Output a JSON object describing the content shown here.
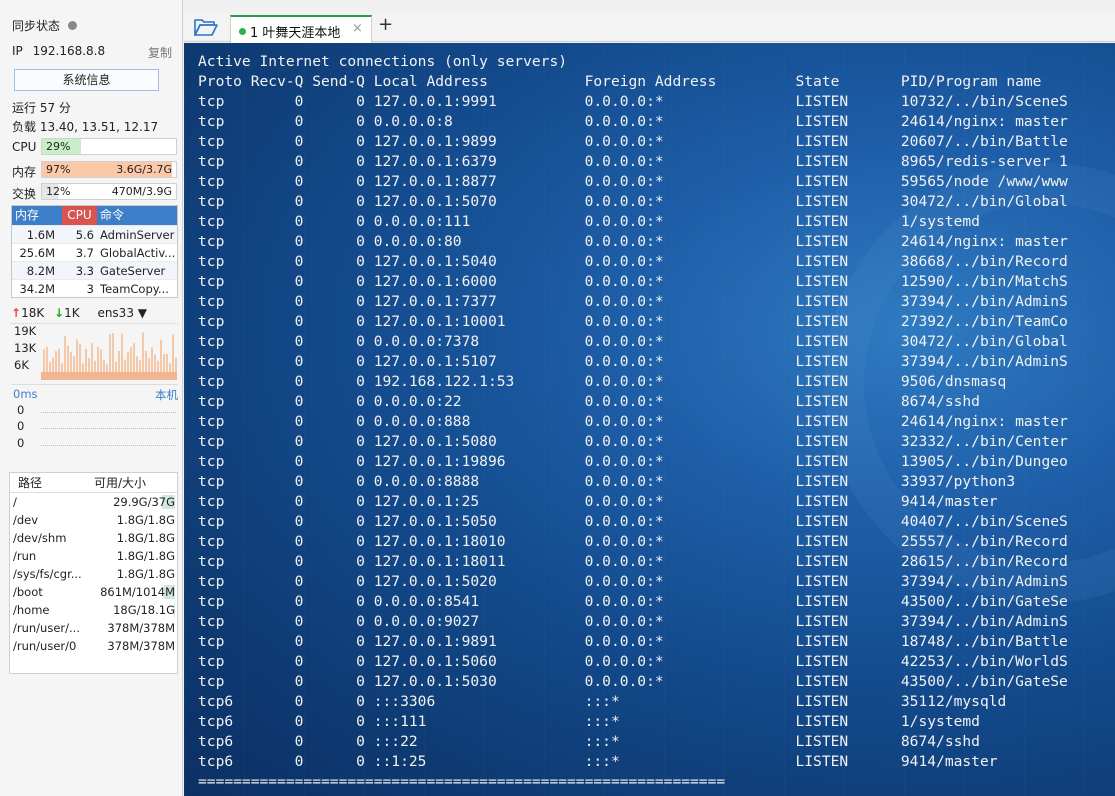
{
  "sidebar": {
    "sync_label": "同步状态",
    "ip_label": "IP",
    "ip_value": "192.168.8.8",
    "copy_label": "复制",
    "sysinfo_button": "系统信息",
    "uptime": "运行 57 分",
    "load": "负载 13.40, 13.51, 12.17",
    "cpu": {
      "label": "CPU",
      "percent_text": "29%",
      "fraction": 0.29,
      "color": "#c8f0c8"
    },
    "mem": {
      "label": "内存",
      "percent_text": "97%",
      "value": "3.6G/3.7G",
      "fraction": 0.97,
      "color": "#fcc9a8"
    },
    "swap": {
      "label": "交换",
      "percent_text": "12%",
      "value": "470M/3.9G",
      "fraction": 0.12,
      "color": "#e6e6e6"
    },
    "proc_headers": {
      "mem": "内存",
      "cpu": "CPU",
      "cmd": "命令"
    },
    "processes": [
      {
        "mem": "1.6M",
        "cpu": "5.6",
        "cmd": "AdminServer"
      },
      {
        "mem": "25.6M",
        "cpu": "3.7",
        "cmd": "GlobalActiv..."
      },
      {
        "mem": "8.2M",
        "cpu": "3.3",
        "cmd": "GateServer"
      },
      {
        "mem": "34.2M",
        "cpu": "3",
        "cmd": "TeamCopy..."
      }
    ],
    "net": {
      "up": "18K",
      "down": "1K",
      "iface": "ens33",
      "ticks": [
        "19K",
        "13K",
        "6K"
      ]
    },
    "ping": {
      "ms": "0ms",
      "host": "本机",
      "values": [
        "0",
        "0",
        "0"
      ]
    },
    "disk_headers": {
      "path": "路径",
      "size": "可用/大小"
    },
    "disks": [
      {
        "path": "/",
        "size": "29.9G/37G",
        "used": 0.19
      },
      {
        "path": "/dev",
        "size": "1.8G/1.8G",
        "used": 0.0
      },
      {
        "path": "/dev/shm",
        "size": "1.8G/1.8G",
        "used": 0.0
      },
      {
        "path": "/run",
        "size": "1.8G/1.8G",
        "used": 0.0
      },
      {
        "path": "/sys/fs/cgr...",
        "size": "1.8G/1.8G",
        "used": 0.0
      },
      {
        "path": "/boot",
        "size": "861M/1014M",
        "used": 0.15
      },
      {
        "path": "/home",
        "size": "18G/18.1G",
        "used": 0.01
      },
      {
        "path": "/run/user/...",
        "size": "378M/378M",
        "used": 0.0
      },
      {
        "path": "/run/user/0",
        "size": "378M/378M",
        "used": 0.0
      }
    ]
  },
  "tabs": {
    "active_label": "1 叶舞天涯本地",
    "close_glyph": "×",
    "add_glyph": "+"
  },
  "terminal": {
    "lines": [
      "Active Internet connections (only servers)",
      "Proto Recv-Q Send-Q Local Address           Foreign Address         State       PID/Program name",
      "tcp        0      0 127.0.0.1:9991          0.0.0.0:*               LISTEN      10732/../bin/SceneS",
      "tcp        0      0 0.0.0.0:8               0.0.0.0:*               LISTEN      24614/nginx: master",
      "tcp        0      0 127.0.0.1:9899          0.0.0.0:*               LISTEN      20607/../bin/Battle",
      "tcp        0      0 127.0.0.1:6379          0.0.0.0:*               LISTEN      8965/redis-server 1",
      "tcp        0      0 127.0.0.1:8877          0.0.0.0:*               LISTEN      59565/node /www/www",
      "tcp        0      0 127.0.0.1:5070          0.0.0.0:*               LISTEN      30472/../bin/Global",
      "tcp        0      0 0.0.0.0:111             0.0.0.0:*               LISTEN      1/systemd",
      "tcp        0      0 0.0.0.0:80              0.0.0.0:*               LISTEN      24614/nginx: master",
      "tcp        0      0 127.0.0.1:5040          0.0.0.0:*               LISTEN      38668/../bin/Record",
      "tcp        0      0 127.0.0.1:6000          0.0.0.0:*               LISTEN      12590/../bin/MatchS",
      "tcp        0      0 127.0.0.1:7377          0.0.0.0:*               LISTEN      37394/../bin/AdminS",
      "tcp        0      0 127.0.0.1:10001         0.0.0.0:*               LISTEN      27392/../bin/TeamCo",
      "tcp        0      0 0.0.0.0:7378            0.0.0.0:*               LISTEN      30472/../bin/Global",
      "tcp        0      0 127.0.0.1:5107          0.0.0.0:*               LISTEN      37394/../bin/AdminS",
      "tcp        0      0 192.168.122.1:53        0.0.0.0:*               LISTEN      9506/dnsmasq",
      "tcp        0      0 0.0.0.0:22              0.0.0.0:*               LISTEN      8674/sshd",
      "tcp        0      0 0.0.0.0:888             0.0.0.0:*               LISTEN      24614/nginx: master",
      "tcp        0      0 127.0.0.1:5080          0.0.0.0:*               LISTEN      32332/../bin/Center",
      "tcp        0      0 127.0.0.1:19896         0.0.0.0:*               LISTEN      13905/../bin/Dungeo",
      "tcp        0      0 0.0.0.0:8888            0.0.0.0:*               LISTEN      33937/python3",
      "tcp        0      0 127.0.0.1:25            0.0.0.0:*               LISTEN      9414/master",
      "tcp        0      0 127.0.0.1:5050          0.0.0.0:*               LISTEN      40407/../bin/SceneS",
      "tcp        0      0 127.0.0.1:18010         0.0.0.0:*               LISTEN      25557/../bin/Record",
      "tcp        0      0 127.0.0.1:18011         0.0.0.0:*               LISTEN      28615/../bin/Record",
      "tcp        0      0 127.0.0.1:5020          0.0.0.0:*               LISTEN      37394/../bin/AdminS",
      "tcp        0      0 0.0.0.0:8541            0.0.0.0:*               LISTEN      43500/../bin/GateSe",
      "tcp        0      0 0.0.0.0:9027            0.0.0.0:*               LISTEN      37394/../bin/AdminS",
      "tcp        0      0 127.0.0.1:9891          0.0.0.0:*               LISTEN      18748/../bin/Battle",
      "tcp        0      0 127.0.0.1:5060          0.0.0.0:*               LISTEN      42253/../bin/WorldS",
      "tcp        0      0 127.0.0.1:5030          0.0.0.0:*               LISTEN      43500/../bin/GateSe",
      "tcp6       0      0 :::3306                 :::*                    LISTEN      35112/mysqld",
      "tcp6       0      0 :::111                  :::*                    LISTEN      1/systemd",
      "tcp6       0      0 :::22                   :::*                    LISTEN      8674/sshd",
      "tcp6       0      0 ::1:25                  :::*                    LISTEN      9414/master",
      "============================================================"
    ]
  }
}
